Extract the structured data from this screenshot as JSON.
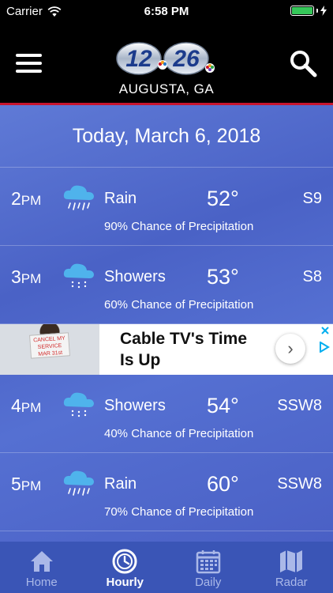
{
  "status_bar": {
    "carrier": "Carrier",
    "time": "6:58 PM"
  },
  "header": {
    "location": "AUGUSTA, GA",
    "logo_text_left": "12",
    "logo_text_right": "26"
  },
  "date_label": "Today, March 6, 2018",
  "hours": [
    {
      "hour": "2",
      "ampm": "PM",
      "icon": "rain-icon",
      "condition": "Rain",
      "temp": "52°",
      "wind": "S9",
      "precip": "90% Chance of Precipitation"
    },
    {
      "hour": "3",
      "ampm": "PM",
      "icon": "showers-icon",
      "condition": "Showers",
      "temp": "53°",
      "wind": "S8",
      "precip": "60% Chance of Precipitation"
    },
    {
      "hour": "4",
      "ampm": "PM",
      "icon": "showers-icon",
      "condition": "Showers",
      "temp": "54°",
      "wind": "SSW8",
      "precip": "40% Chance of Precipitation"
    },
    {
      "hour": "5",
      "ampm": "PM",
      "icon": "rain-icon",
      "condition": "Rain",
      "temp": "60°",
      "wind": "SSW8",
      "precip": "70% Chance of Precipitation"
    }
  ],
  "ad": {
    "headline_line1": "Cable TV's Time",
    "headline_line2": "Is Up",
    "sign_text": "CANCEL MY SERVICE MAR 31st",
    "chevron": "›"
  },
  "tabs": [
    {
      "label": "Home",
      "icon": "home-icon",
      "active": false
    },
    {
      "label": "Hourly",
      "icon": "clock-icon",
      "active": true
    },
    {
      "label": "Daily",
      "icon": "calendar-icon",
      "active": false
    },
    {
      "label": "Radar",
      "icon": "map-icon",
      "active": false
    }
  ],
  "colors": {
    "header_bg": "#000000",
    "accent_red": "#c8152e",
    "content_bg": "#4b63c8",
    "tab_bg": "#3a55b6",
    "battery": "#35c759"
  }
}
